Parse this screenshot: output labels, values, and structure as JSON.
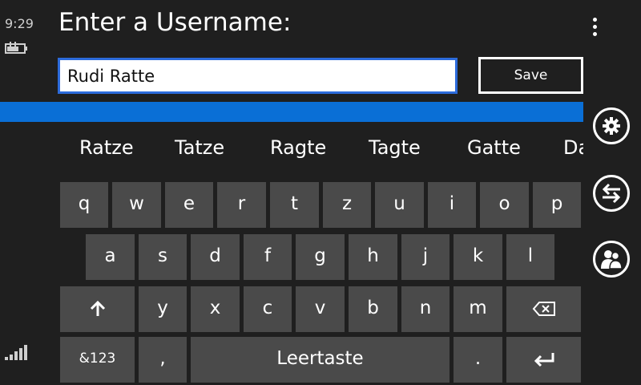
{
  "status": {
    "time": "9:29",
    "battery_icon": "battery-charging-icon",
    "signal_icon": "signal-strength-icon"
  },
  "title": "Enter a Username:",
  "username_input": {
    "value": "Rudi Ratte"
  },
  "save_label": "Save",
  "accent_color": "#0a6fd6",
  "app_bar": {
    "more_icon": "ellipsis-vertical-icon",
    "buttons": [
      {
        "name": "settings",
        "icon": "gear-icon"
      },
      {
        "name": "switch",
        "icon": "swap-arrows-icon"
      },
      {
        "name": "people",
        "icon": "people-icon"
      }
    ]
  },
  "suggestions": [
    "Ratze",
    "Tatze",
    "Ragte",
    "Tagte",
    "Gatte",
    "Da"
  ],
  "keyboard": {
    "row1": [
      "q",
      "w",
      "e",
      "r",
      "t",
      "z",
      "u",
      "i",
      "o",
      "p"
    ],
    "row2": [
      "a",
      "s",
      "d",
      "f",
      "g",
      "h",
      "j",
      "k",
      "l"
    ],
    "row3": [
      "y",
      "x",
      "c",
      "v",
      "b",
      "n",
      "m"
    ],
    "shift_icon": "shift-arrow-icon",
    "backspace_icon": "backspace-icon",
    "numbers_label": "&123",
    "comma_label": ",",
    "space_label": "Leertaste",
    "period_label": ".",
    "enter_icon": "enter-arrow-icon"
  }
}
